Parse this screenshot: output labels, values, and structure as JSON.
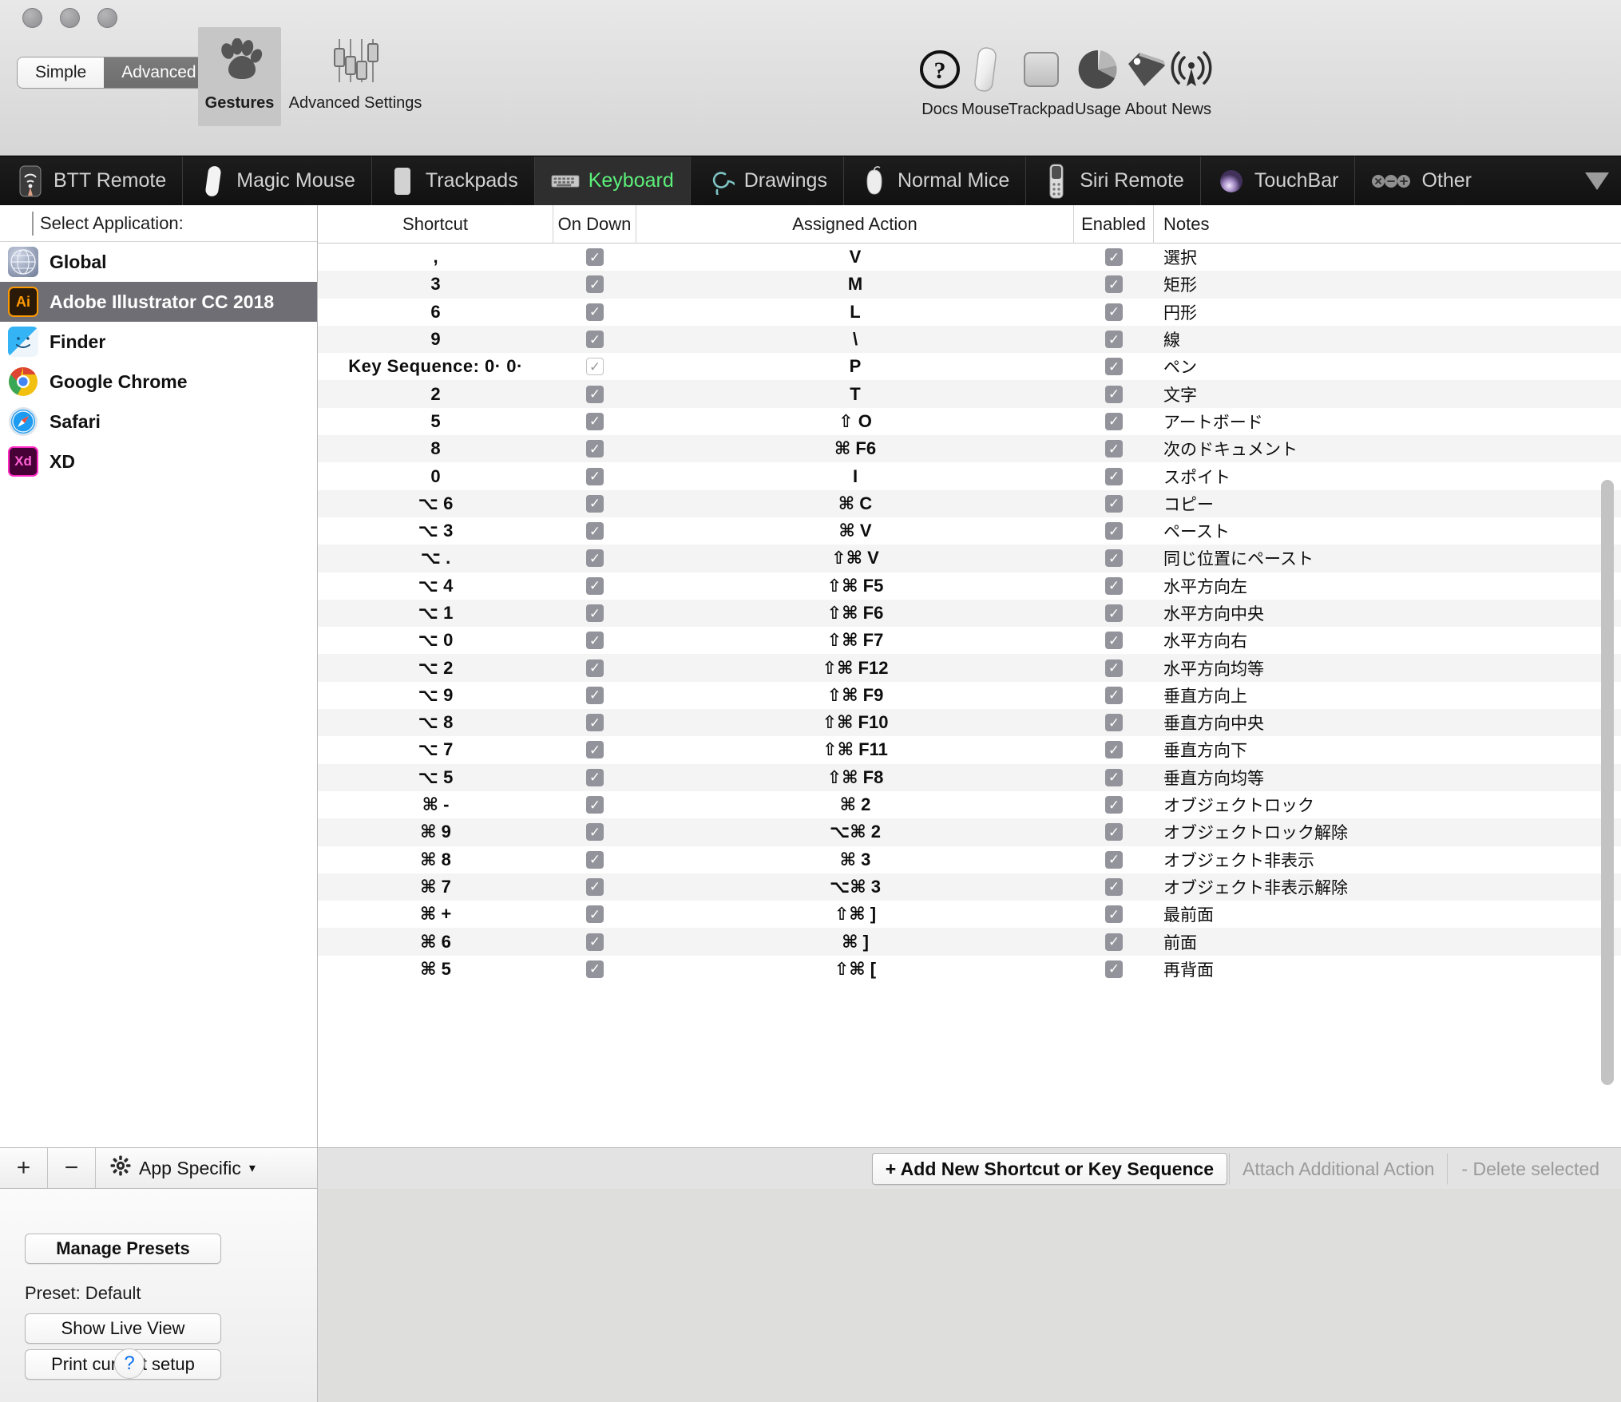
{
  "window": {
    "mode_tabs": [
      {
        "label": "Simple",
        "active": false
      },
      {
        "label": "Advanced",
        "active": true
      }
    ],
    "toolbar_left": [
      {
        "label": "Gestures",
        "icon": "paw-icon",
        "active": true
      },
      {
        "label": "Advanced Settings",
        "icon": "sliders-icon",
        "active": false
      }
    ],
    "toolbar_right": [
      {
        "label": "Docs",
        "icon": "question-circle-icon"
      },
      {
        "label": "Mouse",
        "icon": "magic-mouse-icon"
      },
      {
        "label": "Trackpad",
        "icon": "trackpad-icon"
      },
      {
        "label": "Usage",
        "icon": "pie-chart-icon"
      },
      {
        "label": "About",
        "icon": "tag-icon"
      },
      {
        "label": "News",
        "icon": "broadcast-icon"
      }
    ]
  },
  "device_tabs": [
    {
      "label": "BTT Remote",
      "icon": "btt-remote-icon",
      "active": false
    },
    {
      "label": "Magic Mouse",
      "icon": "magic-mouse-icon",
      "active": false
    },
    {
      "label": "Trackpads",
      "icon": "trackpad-icon",
      "active": false
    },
    {
      "label": "Keyboard",
      "icon": "keyboard-icon",
      "active": true
    },
    {
      "label": "Drawings",
      "icon": "spiral-icon",
      "active": false
    },
    {
      "label": "Normal Mice",
      "icon": "mouse-icon",
      "active": false
    },
    {
      "label": "Siri Remote",
      "icon": "siri-remote-icon",
      "active": false
    },
    {
      "label": "TouchBar",
      "icon": "touchbar-orb-icon",
      "active": false
    },
    {
      "label": "Other",
      "icon": "other-dots-icon",
      "active": false
    }
  ],
  "sidebar": {
    "header": "Select Application:",
    "apps": [
      {
        "name": "Global",
        "icon": "globe-icon",
        "selected": false
      },
      {
        "name": "Adobe Illustrator CC 2018",
        "icon": "illustrator-icon",
        "selected": true
      },
      {
        "name": "Finder",
        "icon": "finder-icon",
        "selected": false
      },
      {
        "name": "Google Chrome",
        "icon": "chrome-icon",
        "selected": false
      },
      {
        "name": "Safari",
        "icon": "safari-icon",
        "selected": false
      },
      {
        "name": "XD",
        "icon": "xd-icon",
        "selected": false
      }
    ],
    "add_label": "+",
    "remove_label": "−",
    "app_specific_label": "App Specific",
    "app_specific_caret": "▾",
    "manage_presets": "Manage Presets",
    "preset_text": "Preset: Default",
    "show_live_view": "Show Live View",
    "print_current_setup": "Print current setup",
    "help": "?"
  },
  "table": {
    "columns": [
      "Shortcut",
      "On Down",
      "Assigned Action",
      "Enabled",
      "Notes"
    ],
    "rows": [
      {
        "shortcut": ",",
        "on_down": true,
        "on_down_light": false,
        "action": "V",
        "enabled": true,
        "notes": "選択"
      },
      {
        "shortcut": "3",
        "on_down": true,
        "on_down_light": false,
        "action": "M",
        "enabled": true,
        "notes": "矩形"
      },
      {
        "shortcut": "6",
        "on_down": true,
        "on_down_light": false,
        "action": "L",
        "enabled": true,
        "notes": "円形"
      },
      {
        "shortcut": "9",
        "on_down": true,
        "on_down_light": false,
        "action": "\\",
        "enabled": true,
        "notes": "線"
      },
      {
        "shortcut": "Key Sequence:   0·  0·",
        "on_down": true,
        "on_down_light": true,
        "action": "P",
        "enabled": true,
        "notes": "ペン"
      },
      {
        "shortcut": "2",
        "on_down": true,
        "on_down_light": false,
        "action": "T",
        "enabled": true,
        "notes": "文字"
      },
      {
        "shortcut": "5",
        "on_down": true,
        "on_down_light": false,
        "action": "⇧ O",
        "enabled": true,
        "notes": "アートボード"
      },
      {
        "shortcut": "8",
        "on_down": true,
        "on_down_light": false,
        "action": "⌘ F6",
        "enabled": true,
        "notes": "次のドキュメント"
      },
      {
        "shortcut": "0",
        "on_down": true,
        "on_down_light": false,
        "action": "I",
        "enabled": true,
        "notes": "スポイト"
      },
      {
        "shortcut": "⌥ 6",
        "on_down": true,
        "on_down_light": false,
        "action": "⌘ C",
        "enabled": true,
        "notes": "コピー"
      },
      {
        "shortcut": "⌥ 3",
        "on_down": true,
        "on_down_light": false,
        "action": "⌘ V",
        "enabled": true,
        "notes": "ペースト"
      },
      {
        "shortcut": "⌥ .",
        "on_down": true,
        "on_down_light": false,
        "action": "⇧⌘ V",
        "enabled": true,
        "notes": "同じ位置にペースト"
      },
      {
        "shortcut": "⌥ 4",
        "on_down": true,
        "on_down_light": false,
        "action": "⇧⌘ F5",
        "enabled": true,
        "notes": "水平方向左"
      },
      {
        "shortcut": "⌥ 1",
        "on_down": true,
        "on_down_light": false,
        "action": "⇧⌘ F6",
        "enabled": true,
        "notes": "水平方向中央"
      },
      {
        "shortcut": "⌥ 0",
        "on_down": true,
        "on_down_light": false,
        "action": "⇧⌘ F7",
        "enabled": true,
        "notes": "水平方向右"
      },
      {
        "shortcut": "⌥ 2",
        "on_down": true,
        "on_down_light": false,
        "action": "⇧⌘ F12",
        "enabled": true,
        "notes": "水平方向均等"
      },
      {
        "shortcut": "⌥ 9",
        "on_down": true,
        "on_down_light": false,
        "action": "⇧⌘ F9",
        "enabled": true,
        "notes": "垂直方向上"
      },
      {
        "shortcut": "⌥ 8",
        "on_down": true,
        "on_down_light": false,
        "action": "⇧⌘ F10",
        "enabled": true,
        "notes": "垂直方向中央"
      },
      {
        "shortcut": "⌥ 7",
        "on_down": true,
        "on_down_light": false,
        "action": "⇧⌘ F11",
        "enabled": true,
        "notes": "垂直方向下"
      },
      {
        "shortcut": "⌥ 5",
        "on_down": true,
        "on_down_light": false,
        "action": "⇧⌘ F8",
        "enabled": true,
        "notes": "垂直方向均等"
      },
      {
        "shortcut": "⌘ -",
        "on_down": true,
        "on_down_light": false,
        "action": "⌘ 2",
        "enabled": true,
        "notes": "オブジェクトロック"
      },
      {
        "shortcut": "⌘ 9",
        "on_down": true,
        "on_down_light": false,
        "action": "⌥⌘ 2",
        "enabled": true,
        "notes": "オブジェクトロック解除"
      },
      {
        "shortcut": "⌘ 8",
        "on_down": true,
        "on_down_light": false,
        "action": "⌘ 3",
        "enabled": true,
        "notes": "オブジェクト非表示"
      },
      {
        "shortcut": "⌘ 7",
        "on_down": true,
        "on_down_light": false,
        "action": "⌥⌘ 3",
        "enabled": true,
        "notes": "オブジェクト非表示解除"
      },
      {
        "shortcut": "⌘ +",
        "on_down": true,
        "on_down_light": false,
        "action": "⇧⌘ ]",
        "enabled": true,
        "notes": "最前面"
      },
      {
        "shortcut": "⌘ 6",
        "on_down": true,
        "on_down_light": false,
        "action": "⌘ ]",
        "enabled": true,
        "notes": "前面"
      },
      {
        "shortcut": "⌘ 5",
        "on_down": true,
        "on_down_light": false,
        "action": "⇧⌘ [",
        "enabled": true,
        "notes": "再背面"
      }
    ],
    "checkmark": "✓"
  },
  "action_bar": {
    "add": "+ Add New Shortcut or Key Sequence",
    "attach": "Attach Additional Action",
    "delete": "- Delete selected"
  }
}
